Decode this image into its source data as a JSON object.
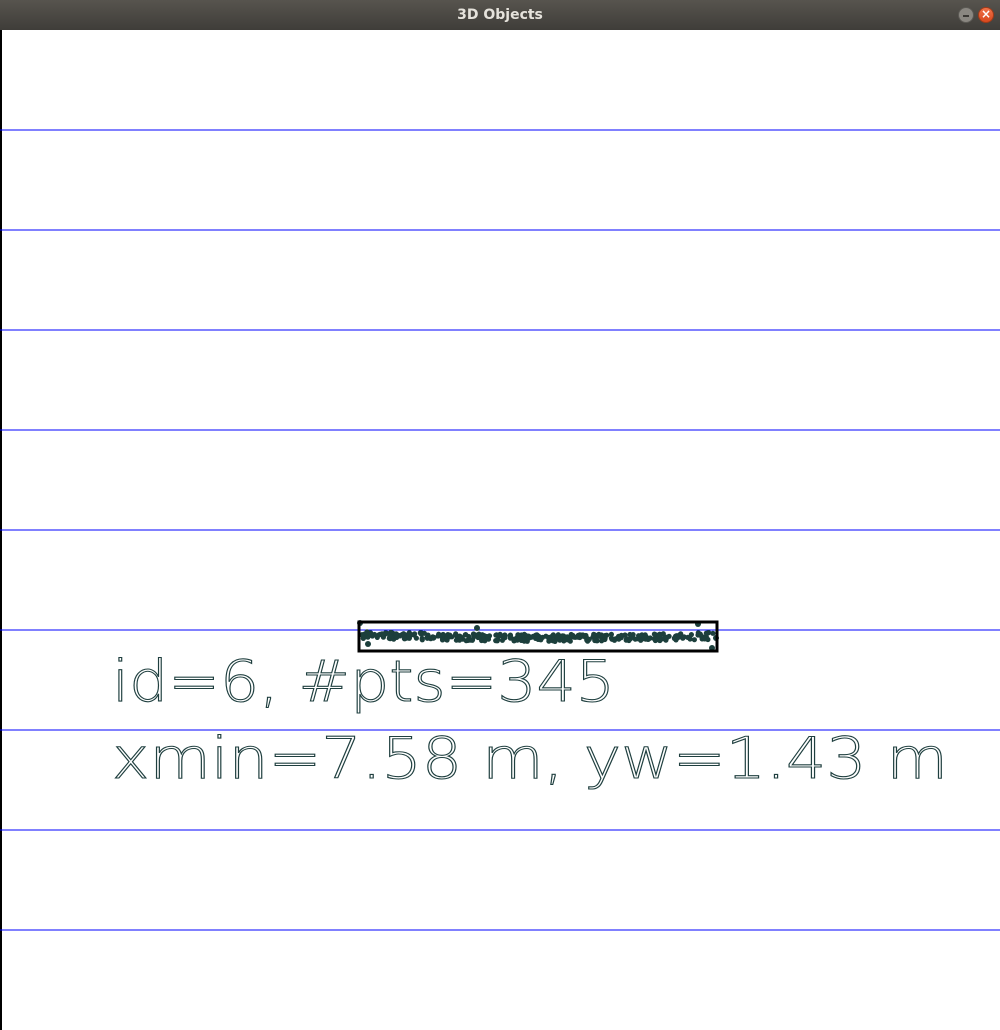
{
  "window": {
    "title": "3D Objects",
    "minimize_glyph": "–",
    "close_glyph": "×"
  },
  "viewer": {
    "background_color": "#ffffff",
    "grid_color": "#0000ff",
    "box_color": "#000000",
    "point_color": "#1c3f3c",
    "text_color": "#1f3f3f"
  },
  "object": {
    "id_line": "id=6, #pts=345",
    "dims_line": "xmin=7.58 m, yw=1.43 m"
  }
}
